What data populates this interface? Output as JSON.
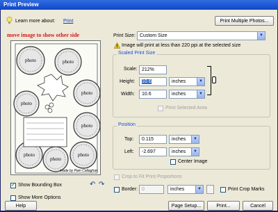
{
  "window": {
    "title": "Print Preview"
  },
  "header": {
    "learn_more_label": "Learn more about:",
    "learn_more_link": "Print",
    "print_multiple_button": "Print Multiple Photos..."
  },
  "preview": {
    "overlay_caption": "move image to show other side",
    "photo_labels": [
      "photo",
      "photo",
      "photo",
      "photo",
      "photo",
      "photo",
      "photo",
      "photo"
    ],
    "footer_credit": "made by Pam Callaghan"
  },
  "print_size": {
    "label": "Print Size:",
    "value": "Custom Size",
    "warning": "Image will print at less than 220 ppi at the selected size"
  },
  "scaled_print_size": {
    "legend": "Scaled Print Size",
    "scale_label": "Scale:",
    "scale_value": "212%",
    "height_label": "Height:",
    "height_value": "10.6",
    "height_unit": "inches",
    "width_label": "Width:",
    "width_value": "10.6",
    "width_unit": "inches",
    "print_selected_area": "Print Selected Area"
  },
  "position": {
    "legend": "Position",
    "top_label": "Top:",
    "top_value": "0.115",
    "top_unit": "inches",
    "left_label": "Left:",
    "left_value": "-2.697",
    "left_unit": "inches",
    "center_image": "Center Image"
  },
  "options": {
    "crop_to_fit": "Crop to Fit Print Proportions",
    "show_bounding_box": "Show Bounding Box",
    "show_more_options": "Show More Options",
    "border_label": "Border:",
    "border_value": "0",
    "border_unit": "inches",
    "print_crop_marks": "Print Crop Marks"
  },
  "buttons": {
    "help": "Help",
    "page_setup": "Page Setup...",
    "print": "Print...",
    "cancel": "Cancel"
  },
  "colors": {
    "caption_red": "#d21a1a",
    "legend_blue": "#1a4fd6",
    "title_bar": "#1146c8",
    "dialog_bg": "#ece9d8"
  }
}
